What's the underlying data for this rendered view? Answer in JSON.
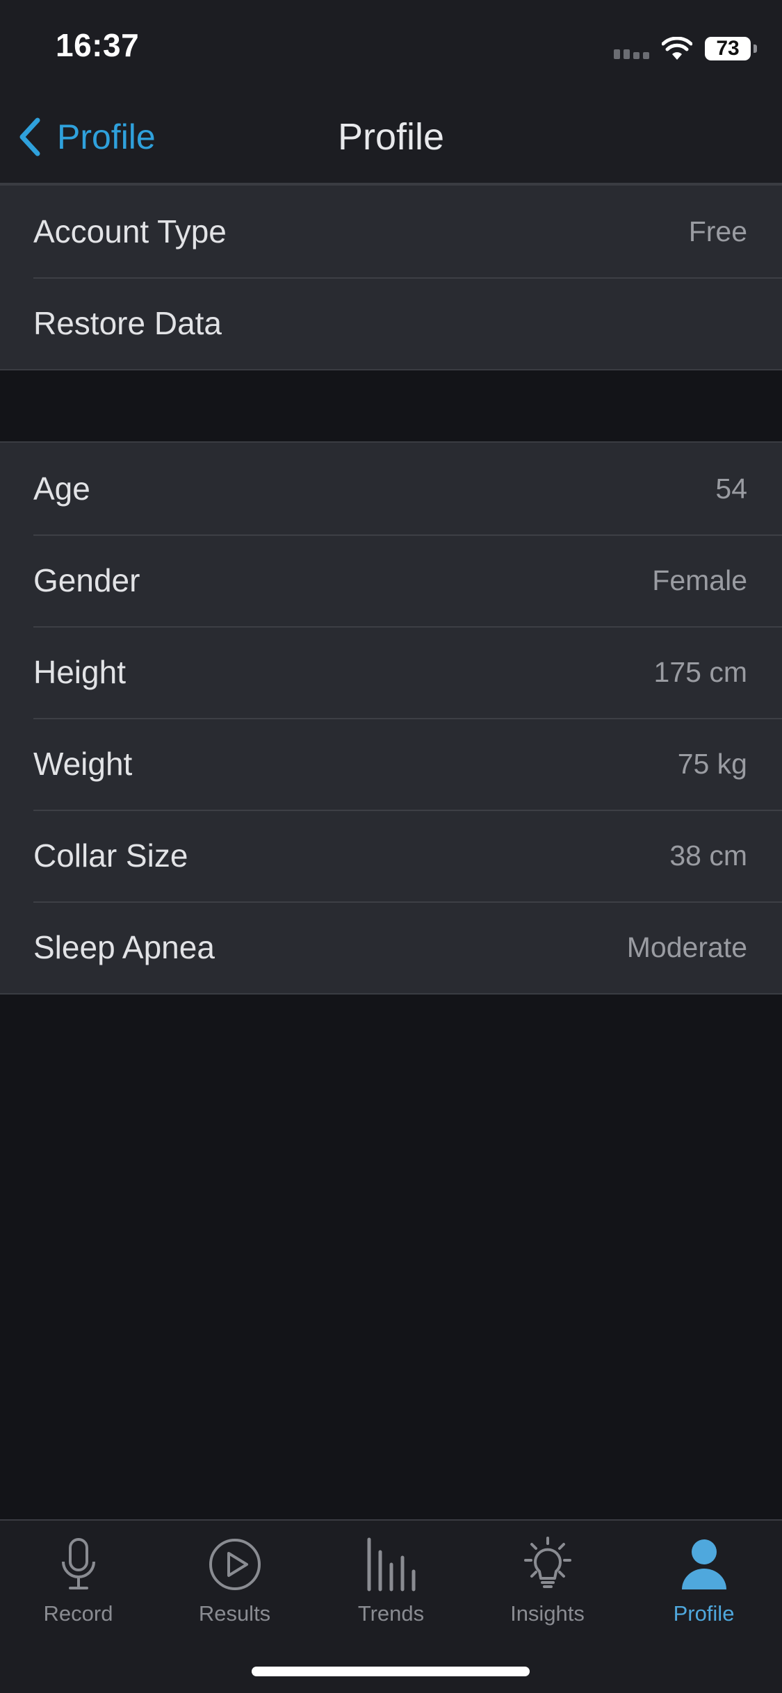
{
  "status_bar": {
    "time": "16:37",
    "battery": "73"
  },
  "nav": {
    "back_label": "Profile",
    "title": "Profile"
  },
  "account_section": [
    {
      "label": "Account Type",
      "value": "Free"
    },
    {
      "label": "Restore Data",
      "value": ""
    }
  ],
  "profile_section": [
    {
      "label": "Age",
      "value": "54"
    },
    {
      "label": "Gender",
      "value": "Female"
    },
    {
      "label": "Height",
      "value": "175 cm"
    },
    {
      "label": "Weight",
      "value": "75 kg"
    },
    {
      "label": "Collar Size",
      "value": "38 cm"
    },
    {
      "label": "Sleep Apnea",
      "value": "Moderate"
    }
  ],
  "tab_bar": {
    "tabs": [
      {
        "label": "Record",
        "icon": "microphone-icon"
      },
      {
        "label": "Results",
        "icon": "play-circle-icon"
      },
      {
        "label": "Trends",
        "icon": "bar-trends-icon"
      },
      {
        "label": "Insights",
        "icon": "lightbulb-icon"
      },
      {
        "label": "Profile",
        "icon": "person-icon"
      }
    ],
    "active": "Profile"
  },
  "colors": {
    "accent": "#2fa1dc",
    "header_background": "#1c1d22",
    "section_background": "#292b31",
    "page_background": "#131418"
  }
}
